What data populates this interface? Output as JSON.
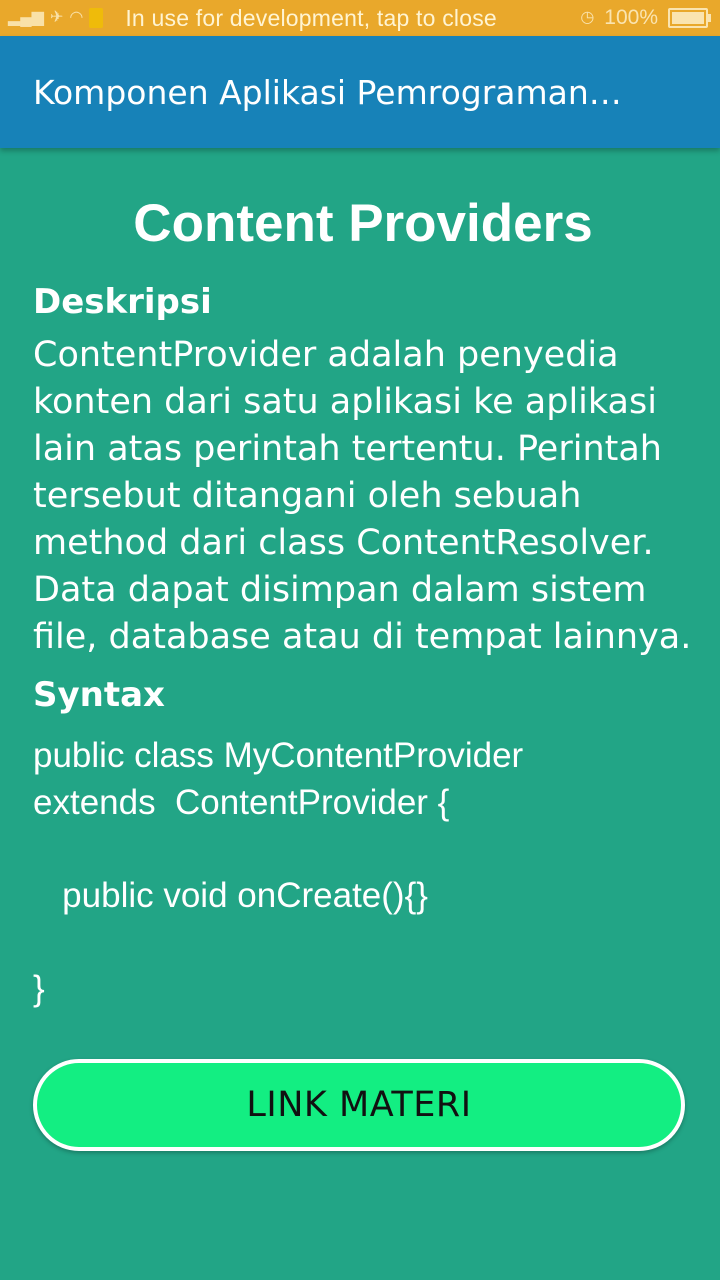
{
  "status_bar": {
    "notification_text": "In use for development, tap to close",
    "battery_text": "100%",
    "icons": [
      "signal-icon",
      "wifi-icon",
      "airplane-icon",
      "alarm-icon",
      "battery-icon"
    ]
  },
  "app_bar": {
    "title": "Komponen Aplikasi Pemrograman…"
  },
  "main": {
    "title": "Content Providers",
    "description_heading": "Deskripsi",
    "description": "ContentProvider adalah penyedia konten dari satu aplikasi ke aplikasi lain atas perintah tertentu. Perintah tersebut ditangani oleh sebuah method dari class ContentResolver. Data dapat disimpan dalam sistem file, database atau di tempat lainnya.",
    "syntax_heading": "Syntax",
    "syntax_code": "public class MyContentProvider\nextends  ContentProvider {\n\n   public void onCreate(){}\n\n}",
    "button_label": "LINK MATERI"
  },
  "colors": {
    "background": "#22a586",
    "app_bar": "#1782b8",
    "status_bar": "#e9a82b",
    "button": "#13ee82"
  }
}
